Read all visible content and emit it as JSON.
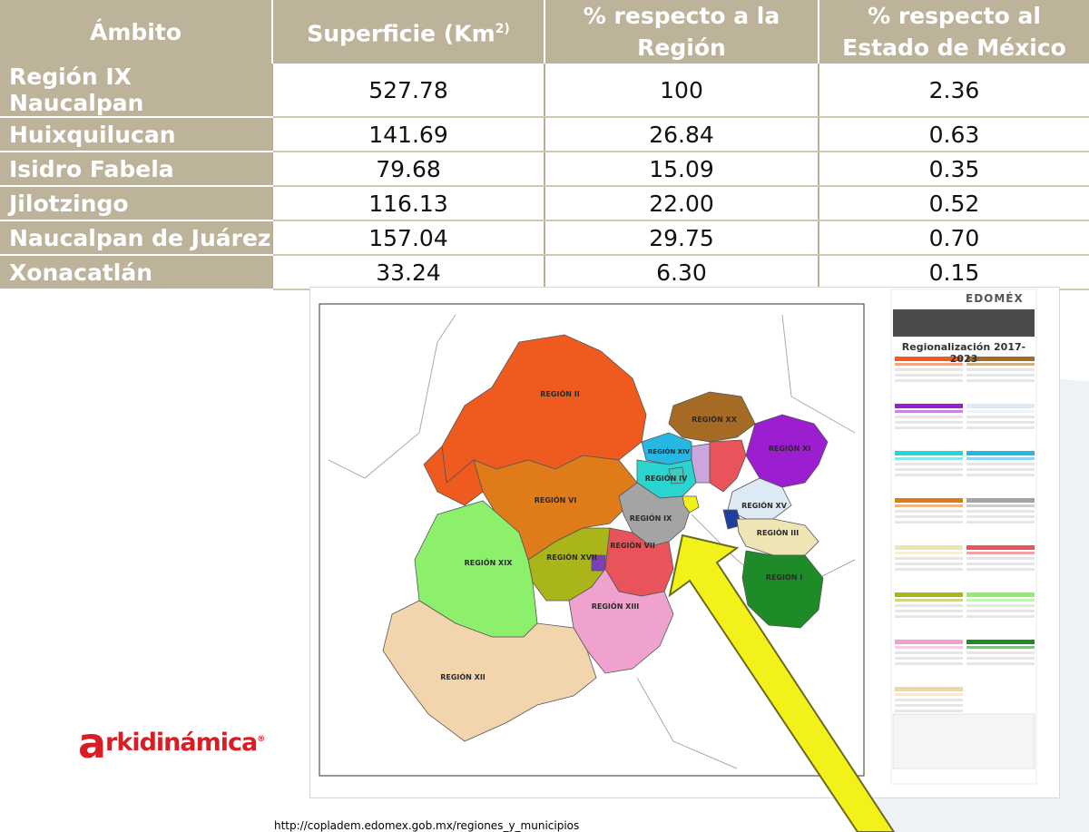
{
  "table": {
    "headers": [
      "Ámbito",
      "Superficie (Km",
      "% respecto a la Región",
      "% respecto al Estado de México"
    ],
    "header_sup": "2)",
    "rows": [
      {
        "ambito": "Región IX Naucalpan",
        "superficie": "527.78",
        "pct_region": "100",
        "pct_estado": "2.36"
      },
      {
        "ambito": "Huixquilucan",
        "superficie": "141.69",
        "pct_region": "26.84",
        "pct_estado": "0.63"
      },
      {
        "ambito": "Isidro Fabela",
        "superficie": "79.68",
        "pct_region": "15.09",
        "pct_estado": "0.35"
      },
      {
        "ambito": "Jilotzingo",
        "superficie": "116.13",
        "pct_region": "22.00",
        "pct_estado": "0.52"
      },
      {
        "ambito": "Naucalpan de Juárez",
        "superficie": "157.04",
        "pct_region": "29.75",
        "pct_estado": "0.70"
      },
      {
        "ambito": "Xonacatlán",
        "superficie": "33.24",
        "pct_region": "6.30",
        "pct_estado": "0.15"
      }
    ]
  },
  "map": {
    "legend_title": "Regionalización 2017-2023",
    "brand": "EDOMÉX",
    "regions": [
      {
        "label": "REGIÓN II",
        "color": "#ef5a1e"
      },
      {
        "label": "REGIÓN XX",
        "color": "#a56b24"
      },
      {
        "label": "REGIÓN XI",
        "color": "#9b1fd0"
      },
      {
        "label": "REGIÓN XV",
        "color": "#dde9f4"
      },
      {
        "label": "REGIÓN IV",
        "color": "#2ad4cf"
      },
      {
        "label": "REGIÓN XIV",
        "color": "#26b7e3"
      },
      {
        "label": "REGIÓN VI",
        "color": "#e07b1a"
      },
      {
        "label": "REGIÓN IX",
        "color": "#a4a4a4"
      },
      {
        "label": "REGIÓN III",
        "color": "#efe4b4"
      },
      {
        "label": "REGIÓN VII",
        "color": "#e8545a"
      },
      {
        "label": "REGIÓN XVII",
        "color": "#a9b518"
      },
      {
        "label": "REGIÓN XIX",
        "color": "#8df06c"
      },
      {
        "label": "REGIÓN XIII",
        "color": "#f0a2cf"
      },
      {
        "label": "REGIÓN I",
        "color": "#1f8a28"
      },
      {
        "label": "REGIÓN XII",
        "color": "#f3d5ad"
      }
    ],
    "highlight_color": "#f2f21a"
  },
  "logo": {
    "initial": "a",
    "rest": "rkidinámica",
    "mark": "®"
  },
  "source_url": "http://copladem.edomex.gob.mx/regiones_y_municipios"
}
